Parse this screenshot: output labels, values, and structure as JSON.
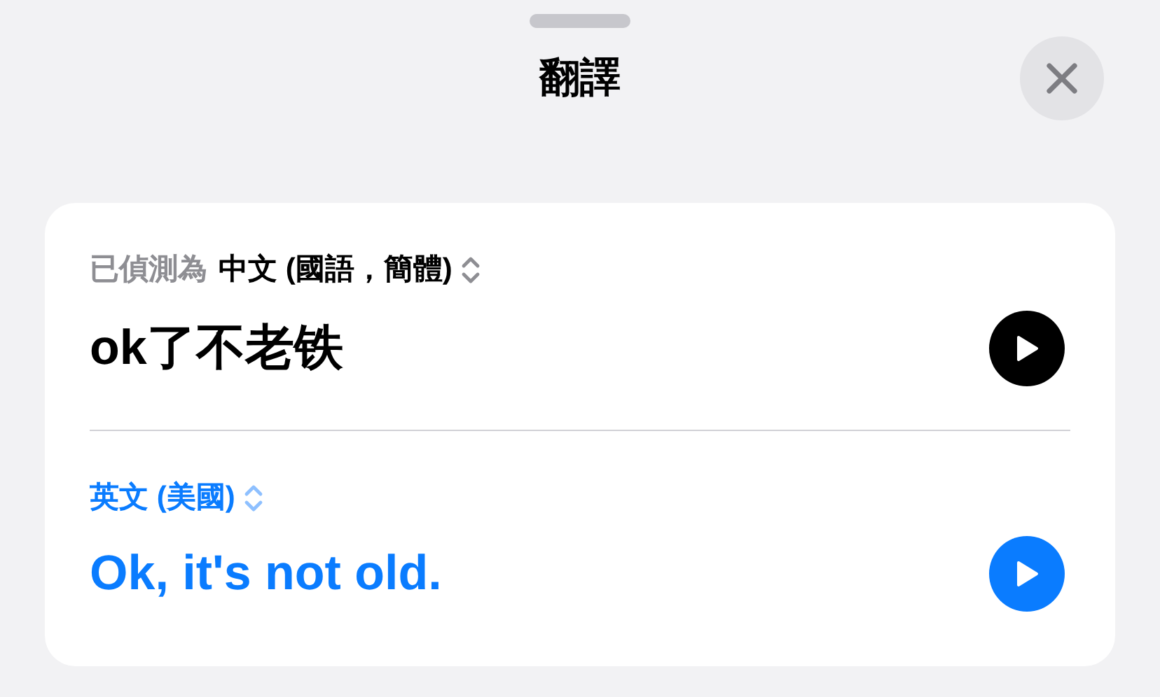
{
  "sheet": {
    "title": "翻譯"
  },
  "source": {
    "detected_label": "已偵測為",
    "language": "中文 (國語，簡體)",
    "text": "ok了不老铁"
  },
  "target": {
    "language": "英文 (美國)",
    "text": "Ok, it's not old."
  }
}
